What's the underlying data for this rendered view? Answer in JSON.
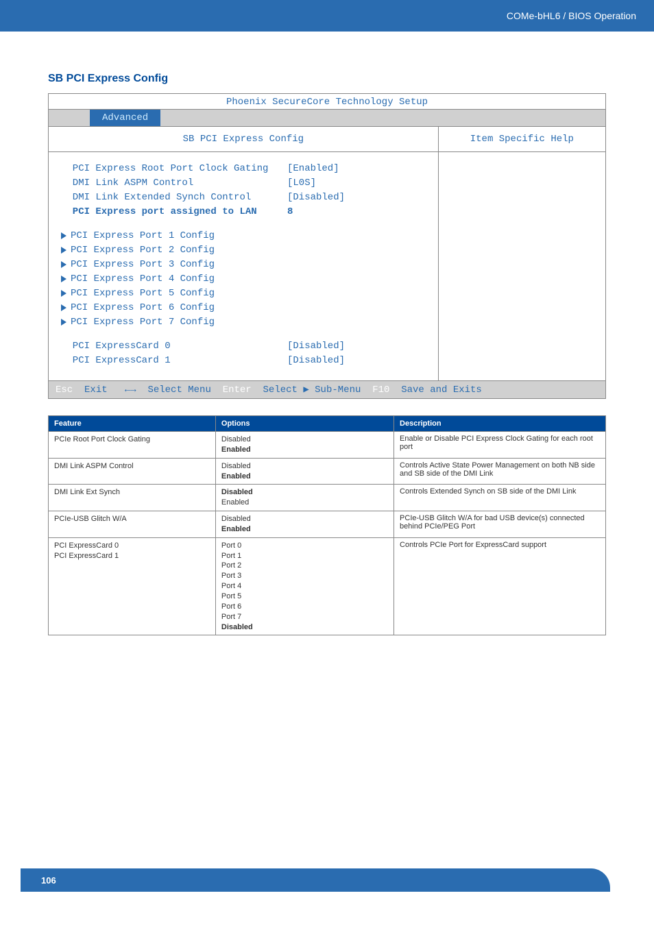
{
  "header": {
    "breadcrumb": "COMe-bHL6 / BIOS Operation"
  },
  "section_title": "SB PCI Express Config",
  "bios": {
    "title": "Phoenix SecureCore Technology Setup",
    "tab_active": "Advanced",
    "left_header": "SB PCI Express Config",
    "right_header": "Item Specific Help",
    "items": [
      {
        "label": "PCI Express Root Port Clock Gating",
        "value": "[Enabled]",
        "type": "setting",
        "bold": false
      },
      {
        "label": "DMI Link ASPM Control",
        "value": "[L0S]",
        "type": "setting",
        "bold": false
      },
      {
        "label": "DMI Link Extended Synch Control",
        "value": "[Disabled]",
        "type": "setting",
        "bold": false
      },
      {
        "label": "PCI Express port assigned to LAN",
        "value": "8",
        "type": "setting",
        "bold": true
      },
      {
        "type": "gap"
      },
      {
        "label": "PCI Express Port 1 Config",
        "type": "submenu"
      },
      {
        "label": "PCI Express Port 2 Config",
        "type": "submenu"
      },
      {
        "label": "PCI Express Port 3 Config",
        "type": "submenu"
      },
      {
        "label": "PCI Express Port 4 Config",
        "type": "submenu"
      },
      {
        "label": "PCI Express Port 5 Config",
        "type": "submenu"
      },
      {
        "label": "PCI Express Port 6 Config",
        "type": "submenu"
      },
      {
        "label": "PCI Express Port 7 Config",
        "type": "submenu"
      },
      {
        "type": "gap"
      },
      {
        "label": "PCI ExpressCard 0",
        "value": "[Disabled]",
        "type": "setting",
        "bold": false
      },
      {
        "label": "PCI ExpressCard 1",
        "value": "[Disabled]",
        "type": "setting",
        "bold": false
      }
    ],
    "footer": {
      "k1": "Esc",
      "t1": "Exit   ←→  Select Menu",
      "k2": "Enter",
      "t2": "Select ▶ Sub-Menu",
      "k3": "F10",
      "t3": "Save and Exits"
    }
  },
  "table": {
    "headers": [
      "Feature",
      "Options",
      "Description"
    ],
    "rows": [
      {
        "feature": "PCIe Root Port Clock Gating",
        "options": [
          {
            "text": "Disabled",
            "bold": false
          },
          {
            "text": "Enabled",
            "bold": true
          }
        ],
        "description": "Enable or Disable PCI Express Clock Gating for each root port"
      },
      {
        "feature": "DMI Link ASPM Control",
        "options": [
          {
            "text": "Disabled",
            "bold": false
          },
          {
            "text": "Enabled",
            "bold": true
          }
        ],
        "description": "Controls Active State Power Management on both NB side and SB side of the DMI Link"
      },
      {
        "feature": "DMI Link Ext Synch",
        "options": [
          {
            "text": "Disabled",
            "bold": true
          },
          {
            "text": "Enabled",
            "bold": false
          }
        ],
        "description": "Controls Extended Synch on SB side of the DMI Link"
      },
      {
        "feature": "PCIe-USB Glitch W/A",
        "options": [
          {
            "text": "Disabled",
            "bold": false
          },
          {
            "text": "Enabled",
            "bold": true
          }
        ],
        "description": "PCIe-USB Glitch W/A for bad USB device(s) connected behind PCIe/PEG Port"
      },
      {
        "feature": "PCI ExpressCard 0\nPCI ExpressCard 1",
        "options": [
          {
            "text": "Port 0",
            "bold": false
          },
          {
            "text": "Port 1",
            "bold": false
          },
          {
            "text": "Port 2",
            "bold": false
          },
          {
            "text": "Port 3",
            "bold": false
          },
          {
            "text": "Port 4",
            "bold": false
          },
          {
            "text": "Port 5",
            "bold": false
          },
          {
            "text": "Port 6",
            "bold": false
          },
          {
            "text": "Port 7",
            "bold": false
          },
          {
            "text": "Disabled",
            "bold": true
          }
        ],
        "description": "Controls PCIe Port for ExpressCard support"
      }
    ]
  },
  "page_number": "106"
}
